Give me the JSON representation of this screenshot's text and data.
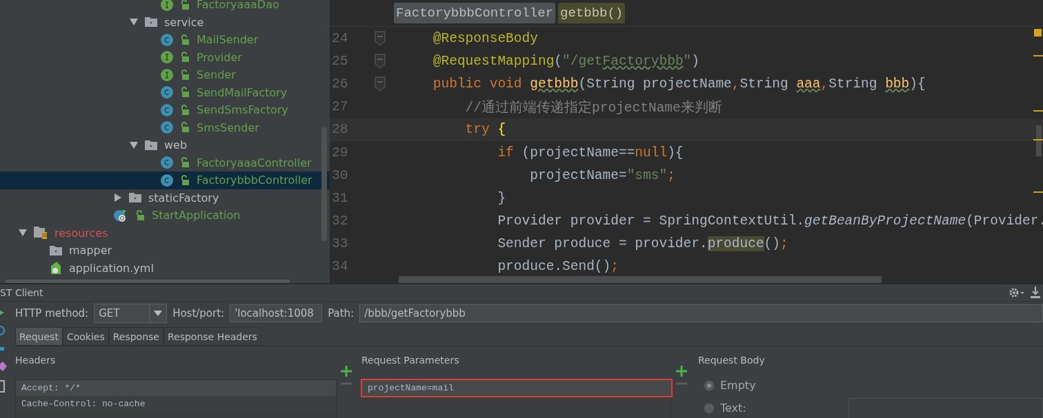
{
  "project_tree": {
    "items": [
      {
        "children": [
          {
            "children": [
              {
                "children": [
                  {
                    "children": [
                      {
                        "children": [
                          {
                            "children": [
                              {
                                "children": [
                                  {
                                    "children": [
                                      {
                                        "kind": "interface",
                                        "label": "FactoryaaaDao",
                                        "selected": false
                                      }
                                    ]
                                  },
                                  {
                                    "kind": "folder",
                                    "label": "service",
                                    "expanded": true,
                                    "selected": false,
                                    "children": [
                                      {
                                        "kind": "class",
                                        "label": "MailSender",
                                        "selected": false
                                      },
                                      {
                                        "kind": "interface",
                                        "label": "Provider",
                                        "selected": false
                                      },
                                      {
                                        "kind": "interface",
                                        "label": "Sender",
                                        "selected": false
                                      },
                                      {
                                        "kind": "class",
                                        "label": "SendMailFactory",
                                        "selected": false
                                      },
                                      {
                                        "kind": "class",
                                        "label": "SendSmsFactory",
                                        "selected": false
                                      },
                                      {
                                        "kind": "class",
                                        "label": "SmsSender",
                                        "selected": false
                                      }
                                    ]
                                  },
                                  {
                                    "kind": "folder",
                                    "label": "web",
                                    "expanded": true,
                                    "selected": false,
                                    "children": [
                                      {
                                        "kind": "class",
                                        "label": "FactoryaaaController",
                                        "selected": false
                                      },
                                      {
                                        "kind": "class",
                                        "label": "FactorybbbController",
                                        "selected": true
                                      }
                                    ]
                                  }
                                ]
                              },
                              {
                                "kind": "folder",
                                "label": "staticFactory",
                                "expanded": false,
                                "selected": false
                              }
                            ]
                          },
                          {
                            "kind": "spring-class",
                            "label": "StartApplication",
                            "selected": false
                          }
                        ]
                      }
                    ]
                  }
                ]
              }
            ]
          }
        ]
      },
      {
        "kind": "resource-folder",
        "label": "resources",
        "expanded": true,
        "selected": false,
        "children": [
          {
            "kind": "folder",
            "label": "mapper",
            "selected": false
          },
          {
            "kind": "yaml",
            "label": "application.yml",
            "selected": false
          }
        ]
      }
    ]
  },
  "editor": {
    "breadcrumbs": [
      {
        "label": "FactorybbbController",
        "selected": false
      },
      {
        "label": "getbbb()",
        "selected": true
      }
    ],
    "lines": [
      {
        "number": "24",
        "fold": true,
        "current": false,
        "tokens": [
          {
            "text": "    @ResponseBody",
            "kind": "annotation"
          }
        ]
      },
      {
        "number": "25",
        "fold": true,
        "current": false,
        "tokens": [
          {
            "text": "    @RequestMapping",
            "kind": "annotation"
          },
          {
            "text": "(",
            "kind": "plain"
          },
          {
            "text": "\"/get",
            "kind": "string"
          },
          {
            "text": "Factorybbb",
            "kind": "string-typo"
          },
          {
            "text": "\"",
            "kind": "string"
          },
          {
            "text": ")",
            "kind": "plain"
          }
        ]
      },
      {
        "number": "26",
        "fold": true,
        "current": false,
        "tokens": [
          {
            "text": "    public void ",
            "kind": "keyword"
          },
          {
            "text": "getbbb",
            "kind": "typo"
          },
          {
            "text": "(String projectName",
            "kind": "plain"
          },
          {
            "text": ",",
            "kind": "keyword"
          },
          {
            "text": "String ",
            "kind": "plain"
          },
          {
            "text": "aaa",
            "kind": "typo"
          },
          {
            "text": ",",
            "kind": "keyword"
          },
          {
            "text": "String ",
            "kind": "plain"
          },
          {
            "text": "bbb",
            "kind": "typo"
          },
          {
            "text": "){",
            "kind": "plain"
          }
        ]
      },
      {
        "number": "27",
        "fold": false,
        "current": false,
        "tokens": [
          {
            "text": "        //通过前端传递指定projectName来判断",
            "kind": "comment"
          }
        ]
      },
      {
        "number": "28",
        "fold": false,
        "current": true,
        "tokens": [
          {
            "text": "        try ",
            "kind": "keyword"
          },
          {
            "text": "{",
            "kind": "brace"
          }
        ]
      },
      {
        "number": "29",
        "fold": false,
        "current": false,
        "tokens": [
          {
            "text": "            if ",
            "kind": "keyword"
          },
          {
            "text": "(projectName==",
            "kind": "plain"
          },
          {
            "text": "null",
            "kind": "keyword"
          },
          {
            "text": "){",
            "kind": "plain"
          }
        ]
      },
      {
        "number": "30",
        "fold": false,
        "current": false,
        "tokens": [
          {
            "text": "                projectName=",
            "kind": "plain"
          },
          {
            "text": "\"sms\"",
            "kind": "string"
          },
          {
            "text": ";",
            "kind": "keyword"
          }
        ]
      },
      {
        "number": "31",
        "fold": false,
        "current": false,
        "tokens": [
          {
            "text": "            }",
            "kind": "plain"
          }
        ]
      },
      {
        "number": "32",
        "fold": false,
        "current": false,
        "tokens": [
          {
            "text": "            Provider provider = SpringContextUtil.",
            "kind": "plain"
          },
          {
            "text": "getBeanByProjectName",
            "kind": "static"
          },
          {
            "text": "(Provider.",
            "kind": "plain"
          }
        ]
      },
      {
        "number": "33",
        "fold": false,
        "current": false,
        "tokens": [
          {
            "text": "            Sender produce = provider.",
            "kind": "plain"
          },
          {
            "text": "produce",
            "kind": "usage"
          },
          {
            "text": "()",
            "kind": "plain"
          },
          {
            "text": ";",
            "kind": "keyword"
          }
        ]
      },
      {
        "number": "34",
        "fold": false,
        "current": false,
        "tokens": [
          {
            "text": "            produce.Send()",
            "kind": "plain"
          },
          {
            "text": ";",
            "kind": "keyword"
          }
        ]
      }
    ]
  },
  "rest_client": {
    "title": "ST Client",
    "method_label": "HTTP method:",
    "method": "GET",
    "host_label": "Host/port:",
    "host": "'localhost:1008",
    "path_label": "Path:",
    "path": "/bbb/getFactorybbb",
    "tabs": [
      {
        "label": "Request",
        "selected": true
      },
      {
        "label": "Cookies",
        "selected": false
      },
      {
        "label": "Response",
        "selected": false
      },
      {
        "label": "Response Headers",
        "selected": false
      }
    ],
    "headers": {
      "title": "Headers",
      "items": [
        "Accept: */*",
        "Cache-Control: no-cache"
      ]
    },
    "request_parameters": {
      "title": "Request Parameters",
      "annotated": true,
      "items": [
        "projectName=mail"
      ]
    },
    "request_body": {
      "title": "Request Body",
      "options": [
        {
          "label": "Empty",
          "selected": true
        },
        {
          "label": "Text:",
          "selected": false
        }
      ]
    }
  }
}
